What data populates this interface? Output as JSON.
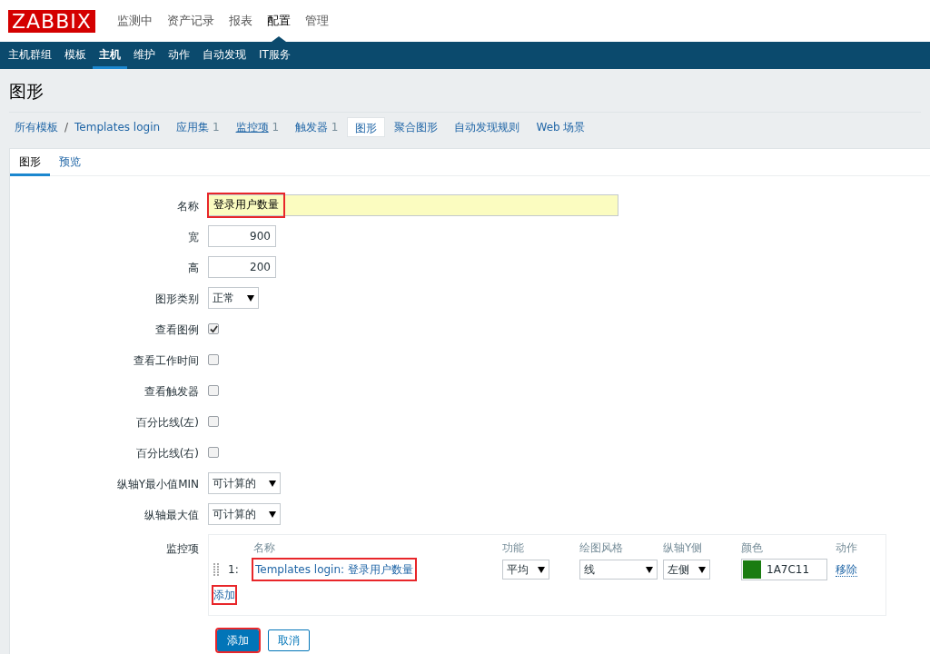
{
  "logo": "ZABBIX",
  "main_menu": [
    {
      "label": "监测中",
      "selected": false
    },
    {
      "label": "资产记录",
      "selected": false
    },
    {
      "label": "报表",
      "selected": false
    },
    {
      "label": "配置",
      "selected": true
    },
    {
      "label": "管理",
      "selected": false
    }
  ],
  "sub_menu": [
    {
      "label": "主机群组",
      "selected": false
    },
    {
      "label": "模板",
      "selected": false
    },
    {
      "label": "主机",
      "selected": true
    },
    {
      "label": "维护",
      "selected": false
    },
    {
      "label": "动作",
      "selected": false
    },
    {
      "label": "自动发现",
      "selected": false
    },
    {
      "label": "IT服务",
      "selected": false
    }
  ],
  "page_title": "图形",
  "breadcrumb": [
    {
      "label": "所有模板"
    },
    {
      "label": "Templates login"
    }
  ],
  "host_tabs": [
    {
      "label": "应用集",
      "count": "1",
      "selected": false,
      "underlined": false
    },
    {
      "label": "监控项",
      "count": "1",
      "selected": false,
      "underlined": true
    },
    {
      "label": "触发器",
      "count": "1",
      "selected": false,
      "underlined": false
    },
    {
      "label": "图形",
      "selected": true,
      "underlined": false
    },
    {
      "label": "聚合图形",
      "selected": false,
      "underlined": false
    },
    {
      "label": "自动发现规则",
      "selected": false,
      "underlined": false
    },
    {
      "label": "Web 场景",
      "selected": false,
      "underlined": false
    }
  ],
  "breadcrumb_separator": "/",
  "form_tabs": [
    {
      "label": "图形",
      "selected": true
    },
    {
      "label": "预览",
      "selected": false
    }
  ],
  "fields": [
    {
      "kind": "text",
      "label": "名称",
      "value": "登录用户数量",
      "highlighted": true
    },
    {
      "kind": "number",
      "label": "宽",
      "value": "900"
    },
    {
      "kind": "number",
      "label": "高",
      "value": "200"
    },
    {
      "kind": "select",
      "label": "图形类别",
      "value": "正常"
    },
    {
      "kind": "checkbox",
      "label": "查看图例",
      "checked": true
    },
    {
      "kind": "checkbox",
      "label": "查看工作时间",
      "checked": false
    },
    {
      "kind": "checkbox",
      "label": "查看触发器",
      "checked": false
    },
    {
      "kind": "checkbox",
      "label": "百分比线(左)",
      "checked": false
    },
    {
      "kind": "checkbox",
      "label": "百分比线(右)",
      "checked": false
    },
    {
      "kind": "select",
      "label": "纵轴Y最小值MIN",
      "value": "可计算的"
    },
    {
      "kind": "select",
      "label": "纵轴最大值",
      "value": "可计算的"
    }
  ],
  "items": {
    "label": "监控项",
    "columns": [
      "名称",
      "功能",
      "绘图风格",
      "纵轴Y侧",
      "颜色",
      "动作"
    ],
    "rows": [
      {
        "index": "1:",
        "name": "Templates login: 登录用户数量",
        "highlighted": true,
        "function": "平均",
        "style": "线",
        "y_side": "左侧",
        "color": "#1a7c11",
        "color_code": "1A7C11",
        "action": "移除"
      }
    ],
    "add_link": {
      "label": "添加",
      "highlighted": true
    }
  },
  "buttons": [
    {
      "kind": "primary",
      "label": "添加",
      "highlighted": true
    },
    {
      "kind": "secondary",
      "label": "取消",
      "highlighted": false
    }
  ]
}
